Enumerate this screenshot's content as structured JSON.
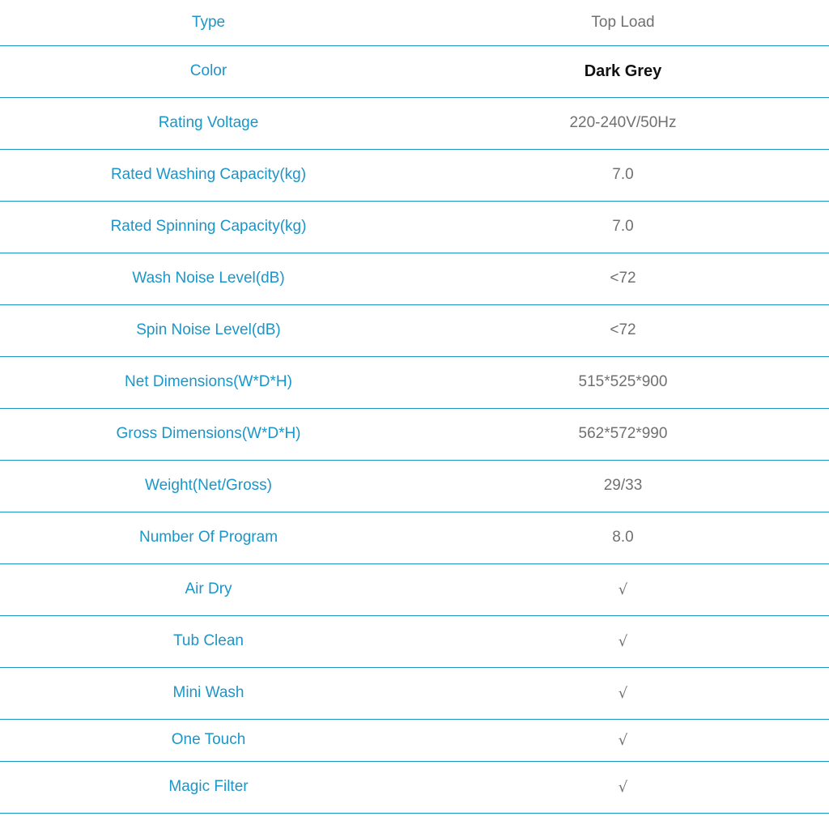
{
  "specs": [
    {
      "label": "Type",
      "value": "Top Load"
    },
    {
      "label": "Color",
      "value": "Dark Grey"
    },
    {
      "label": "Rating Voltage",
      "value": "220-240V/50Hz"
    },
    {
      "label": "Rated Washing Capacity(kg)",
      "value": "7.0"
    },
    {
      "label": "Rated Spinning Capacity(kg)",
      "value": "7.0"
    },
    {
      "label": "Wash Noise Level(dB)",
      "value": "<72"
    },
    {
      "label": "Spin Noise Level(dB)",
      "value": "<72"
    },
    {
      "label": "Net Dimensions(W*D*H)",
      "value": "515*525*900"
    },
    {
      "label": "Gross Dimensions(W*D*H)",
      "value": "562*572*990"
    },
    {
      "label": "Weight(Net/Gross)",
      "value": "29/33"
    },
    {
      "label": "Number Of Program",
      "value": "8.0"
    },
    {
      "label": "Air Dry",
      "value": "√"
    },
    {
      "label": "Tub Clean",
      "value": "√"
    },
    {
      "label": "Mini Wash",
      "value": "√"
    },
    {
      "label": "One Touch",
      "value": "√"
    },
    {
      "label": "Magic Filter",
      "value": "√"
    }
  ]
}
